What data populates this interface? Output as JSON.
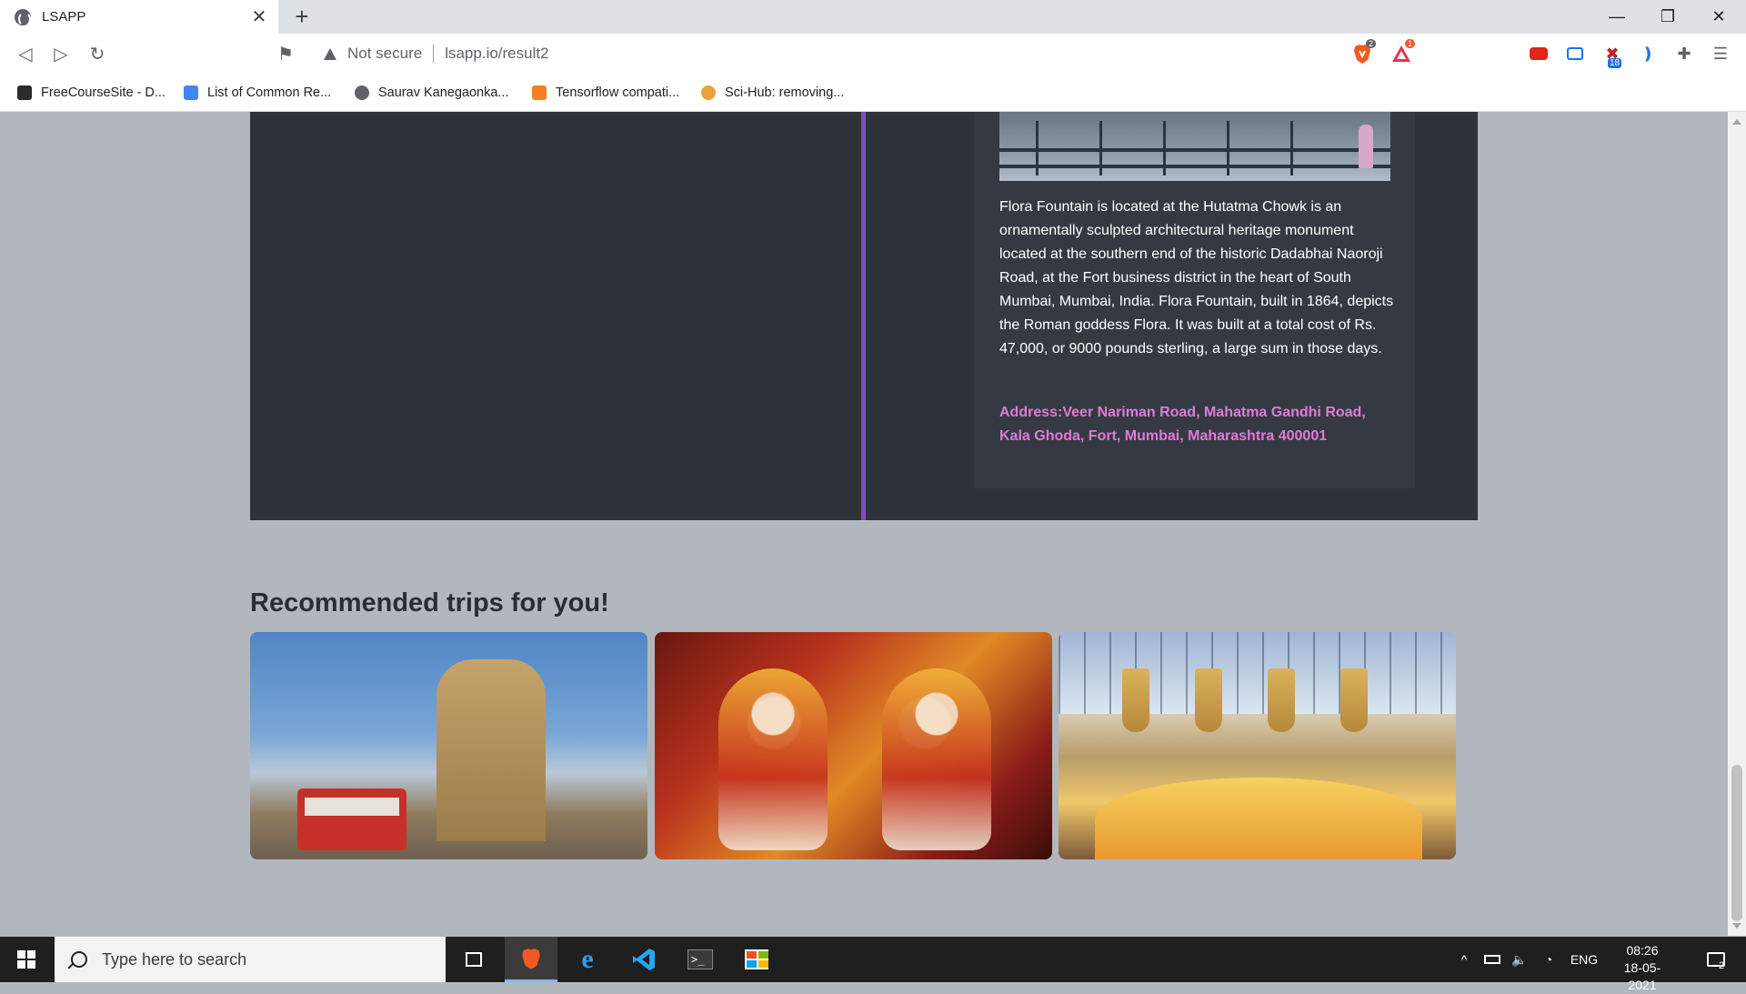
{
  "browser": {
    "tab_title": "LSAPP",
    "new_tab_label": "+",
    "security_text": "Not secure",
    "url": "lsapp.io/result2",
    "brave_shield_count": "2",
    "brave_rewards_count": "1",
    "extension_badge": "18"
  },
  "bookmarks": [
    {
      "label": "FreeCourseSite - D..."
    },
    {
      "label": "List of Common Re..."
    },
    {
      "label": "Saurav Kanegaonka..."
    },
    {
      "label": "Tensorflow compati..."
    },
    {
      "label": "Sci-Hub: removing..."
    }
  ],
  "page": {
    "card": {
      "description": "Flora Fountain is located at the Hutatma Chowk is an ornamentally sculpted architectural heritage monument located at the southern end of the historic Dadabhai Naoroji Road, at the Fort business district in the heart of South Mumbai, Mumbai, India. Flora Fountain, built in 1864, depicts the Roman goddess Flora. It was built at a total cost of Rs. 47,000, or 9000 pounds sterling, a large sum in those days.",
      "address": "Address:Veer Nariman Road, Mahatma Gandhi Road, Kala Ghoda, Fort, Mumbai, Maharashtra 400001"
    },
    "recommended_title": "Recommended trips for you!"
  },
  "taskbar": {
    "search_placeholder": "Type here to search",
    "language": "ENG",
    "time": "08:26",
    "date": "18-05-2021",
    "notification_count": "2"
  },
  "colors": {
    "page_background": "#b2b7be",
    "panel": "#2e333a",
    "divider": "#7b4fc4",
    "address_text": "#e07ad8"
  }
}
